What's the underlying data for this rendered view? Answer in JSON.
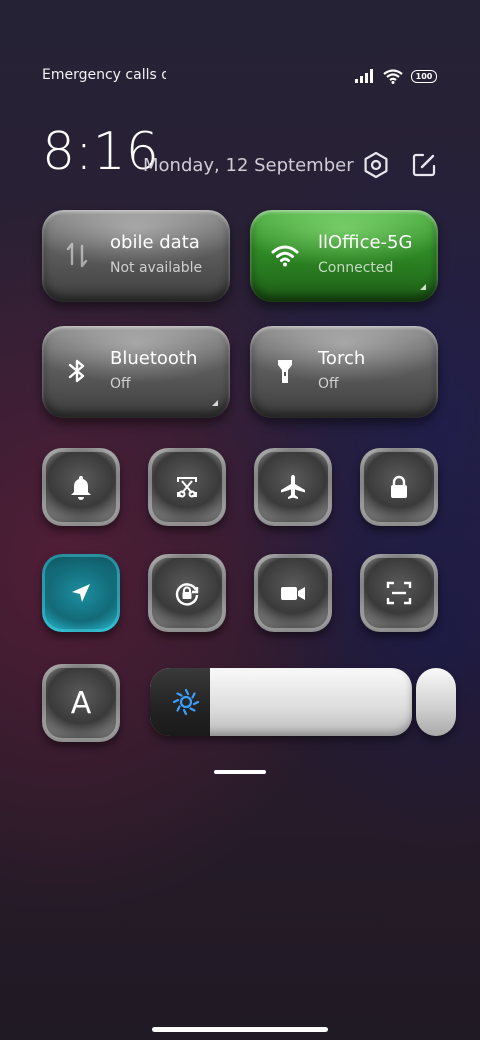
{
  "status_bar": {
    "carrier_text": "Emergency calls o",
    "battery": "100",
    "icons": [
      "signal-icon",
      "wifi-icon",
      "battery-icon"
    ]
  },
  "header": {
    "time": "8:16",
    "date": "Monday, 12 September",
    "icons": [
      "settings-icon",
      "edit-icon"
    ]
  },
  "big_tiles": [
    {
      "title": "obile data",
      "subtitle": "Not available",
      "icon": "mobile-data-icon",
      "active": false
    },
    {
      "title": "llOffice-5G",
      "subtitle": "Connected",
      "icon": "wifi-icon",
      "active": true
    },
    {
      "title": "Bluetooth",
      "subtitle": "Off",
      "icon": "bluetooth-icon",
      "active": false
    },
    {
      "title": "Torch",
      "subtitle": "Off",
      "icon": "torch-icon",
      "active": false
    }
  ],
  "small_tiles": [
    {
      "icon": "bell-icon",
      "active": false
    },
    {
      "icon": "screenshot-icon",
      "active": false
    },
    {
      "icon": "airplane-icon",
      "active": false
    },
    {
      "icon": "lock-icon",
      "active": false
    },
    {
      "icon": "location-icon",
      "active": true
    },
    {
      "icon": "rotation-lock-icon",
      "active": false
    },
    {
      "icon": "video-camera-icon",
      "active": false
    },
    {
      "icon": "scan-icon",
      "active": false
    },
    {
      "icon": "font-a-icon",
      "active": false
    }
  ],
  "small_tile_letter": "A",
  "brightness": {
    "icon": "brightness-icon",
    "level": 0.23
  },
  "colors": {
    "wifi_active": "#2f8a25",
    "location_active": "#167f90",
    "brightness_icon": "#3aa0ff"
  }
}
